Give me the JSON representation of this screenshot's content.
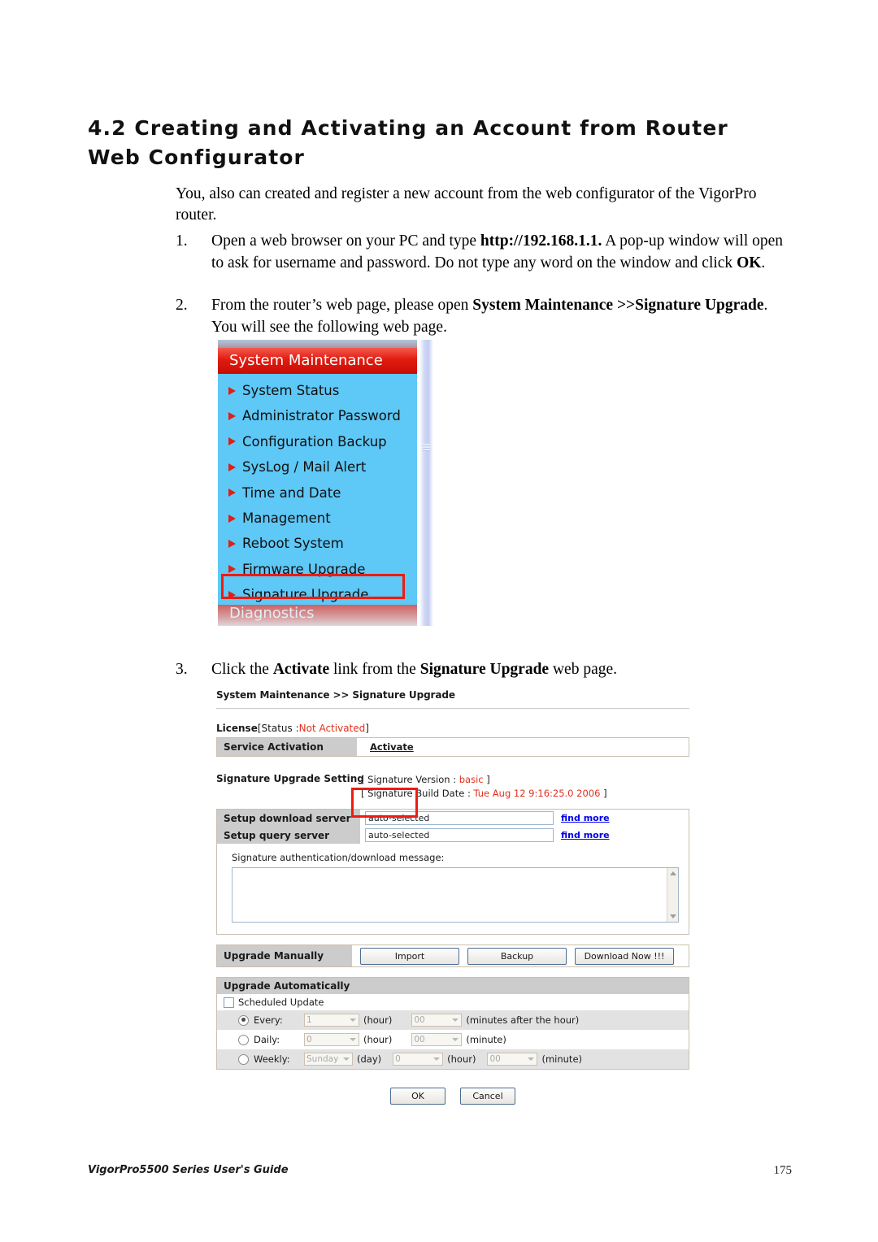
{
  "heading": "4.2 Creating and Activating an Account from Router Web Configurator",
  "intro": "You, also can created and register a new account from the web configurator of the VigorPro router.",
  "steps": [
    {
      "num": "1.",
      "pre": "Open a web browser on your PC and type ",
      "bold1": "http://192.168.1.1.",
      "mid": " A pop-up window will open to ask for username and password. Do not type any word on the window and click ",
      "bold2": "OK",
      "post": "."
    },
    {
      "num": "2.",
      "pre": "From the router’s web page, please open ",
      "bold1": "System Maintenance >>Signature Upgrade",
      "mid": ". You will see the following web page.",
      "bold2": "",
      "post": ""
    },
    {
      "num": "3.",
      "pre": "Click the ",
      "bold1": "Activate",
      "mid": " link from the ",
      "bold2": "Signature Upgrade",
      "post": " web page."
    }
  ],
  "router_menu": {
    "header": "System Maintenance",
    "footer": "Diagnostics",
    "items": [
      {
        "label": "System Status"
      },
      {
        "label": "Administrator Password"
      },
      {
        "label": "Configuration Backup"
      },
      {
        "label": "SysLog / Mail Alert"
      },
      {
        "label": "Time and Date"
      },
      {
        "label": "Management"
      },
      {
        "label": "Reboot System"
      },
      {
        "label": "Firmware Upgrade"
      },
      {
        "label": "Signature Upgrade"
      }
    ],
    "colors": {
      "header_red": "#e11b10",
      "panel_blue": "#5ec8f7",
      "bullet_red": "#e01f12",
      "highlight_red": "#ee1c10"
    }
  },
  "web_page": {
    "breadcrumb": "System Maintenance >> Signature Upgrade",
    "license": {
      "label": "License",
      "status_prefix": "[Status :",
      "status_value": "Not Activated",
      "status_suffix": "]",
      "row_label": "Service Activation",
      "activate_link": "Activate"
    },
    "signature_setting": {
      "label": "Signature Upgrade Setting",
      "version_prefix": "[ Signature Version : ",
      "version_value": "basic",
      "version_suffix": " ]",
      "builddate_prefix": "[ Signature Build Date : ",
      "builddate_value": "Tue Aug 12 9:16:25.0 2006",
      "builddate_suffix": " ]"
    },
    "servers": [
      {
        "label": "Setup download server",
        "value": "auto-selected",
        "link": "find more"
      },
      {
        "label": "Setup query server",
        "value": "auto-selected",
        "link": "find more"
      }
    ],
    "message": {
      "label": "Signature authentication/download message:",
      "value": ""
    },
    "upgrade_manually": {
      "label": "Upgrade Manually",
      "buttons": [
        "Import",
        "Backup",
        "Download Now !!!"
      ]
    },
    "upgrade_automatically": {
      "label": "Upgrade Automatically",
      "checkbox_label": "Scheduled Update",
      "checkbox_checked": false,
      "rows": [
        {
          "name": "Every:",
          "selected": true,
          "fields": [
            {
              "value": "1",
              "unit": "(hour)"
            },
            {
              "value": "00",
              "unit": "(minutes after the hour)"
            }
          ]
        },
        {
          "name": "Daily:",
          "selected": false,
          "fields": [
            {
              "value": "0",
              "unit": "(hour)"
            },
            {
              "value": "00",
              "unit": "(minute)"
            }
          ]
        },
        {
          "name": "Weekly:",
          "selected": false,
          "fields": [
            {
              "value": "Sunday",
              "unit": "(day)"
            },
            {
              "value": "0",
              "unit": "(hour)"
            },
            {
              "value": "00",
              "unit": "(minute)"
            }
          ]
        }
      ]
    },
    "footer_buttons": [
      "OK",
      "Cancel"
    ],
    "colors": {
      "red_value": "#e0301e",
      "label_gray": "#cccccc",
      "panel_border": "#cbbfb0"
    }
  },
  "doc_footer": {
    "left": "VigorPro5500 Series User's Guide",
    "page": "175"
  }
}
